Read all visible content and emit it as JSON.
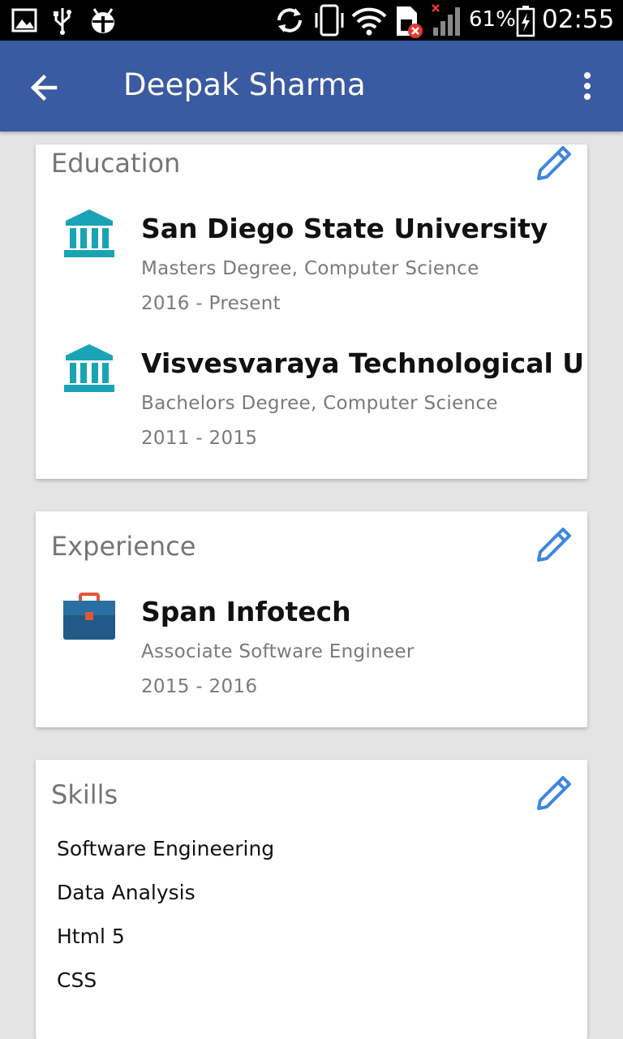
{
  "status_bar": {
    "battery_percent": "61%",
    "time": "02:55",
    "icons": [
      "gallery-icon",
      "usb-icon",
      "android-debug-icon",
      "sync-icon",
      "vibrate-icon",
      "wifi-icon",
      "sim-error-icon",
      "signal-icon",
      "battery-charging-icon"
    ]
  },
  "app_bar": {
    "title": "Deepak Sharma",
    "color": "#3a5aa1"
  },
  "education": {
    "title": "Education",
    "items": [
      {
        "name": "San Diego State University",
        "degree": "Masters Degree, Computer Science",
        "dates": "2016 - Present"
      },
      {
        "name": "Visvesvaraya Technological U",
        "degree": "Bachelors Degree, Computer Science",
        "dates": "2011 - 2015"
      }
    ]
  },
  "experience": {
    "title": "Experience",
    "items": [
      {
        "name": "Span Infotech",
        "role": "Associate Software Engineer",
        "dates": "2015 - 2016"
      }
    ]
  },
  "skills": {
    "title": "Skills",
    "items": [
      "Software Engineering",
      "Data Analysis",
      "Html 5",
      "CSS"
    ]
  },
  "colors": {
    "institution_icon": "#1aa3b5",
    "edit_icon": "#3d86e0",
    "briefcase": "#205a86"
  }
}
